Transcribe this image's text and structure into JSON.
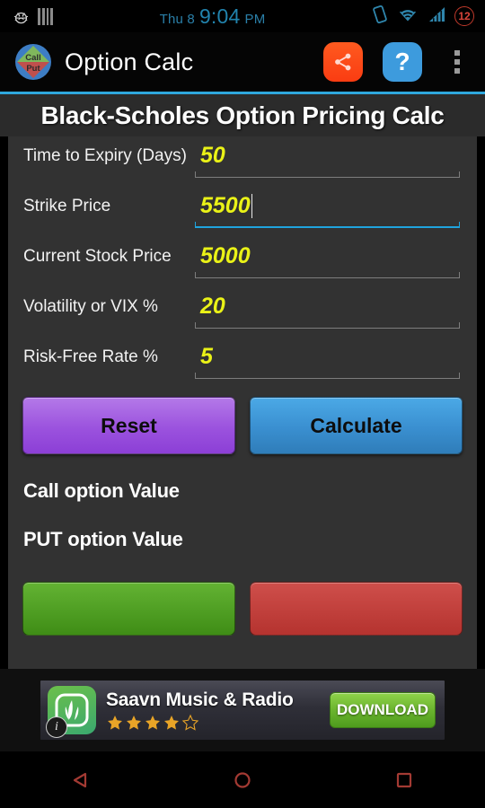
{
  "status_bar": {
    "icons_left": [
      "bug-icon",
      "barcode-icon"
    ],
    "day": "Thu 8",
    "time": "9:04",
    "meridiem": "PM",
    "icons_right": [
      "vibrate-icon",
      "wifi-icon",
      "signal-icon"
    ],
    "battery_level": "12",
    "battery_color": "#d8453a",
    "time_color": "#2183ad"
  },
  "action_bar": {
    "app_icon_call": "Call",
    "app_icon_put": "Put",
    "title": "Option Calc",
    "share_label": "share-icon",
    "help_label": "?",
    "overflow_label": "overflow-menu",
    "share_color": "#fa3c12",
    "help_color": "#3d9bdd",
    "divider_color": "#2fa8dd"
  },
  "page": {
    "title": "Black-Scholes Option Pricing Calc"
  },
  "form": {
    "fields": [
      {
        "label": "Time to Expiry (Days)",
        "value": "50",
        "focused": false
      },
      {
        "label": "Strike Price",
        "value": "5500",
        "focused": true
      },
      {
        "label": "Current Stock Price",
        "value": "5000",
        "focused": false
      },
      {
        "label": "Volatility or VIX  %",
        "value": "20",
        "focused": false
      },
      {
        "label": "Risk-Free Rate  %",
        "value": "5",
        "focused": false
      }
    ],
    "value_color": "#eaf217",
    "focus_color": "#1fa3dd"
  },
  "buttons": {
    "reset": "Reset",
    "calculate": "Calculate",
    "reset_color": "#9b52de",
    "calculate_color": "#3a8fd0"
  },
  "results": {
    "call_label": "Call option Value",
    "call_value": "",
    "put_label": "PUT option Value",
    "put_value": "",
    "green_button_color": "#3f8d16",
    "red_button_color": "#b5332f"
  },
  "ad": {
    "title": "Saavn Music & Radio",
    "rating": 4,
    "rating_max": 5,
    "cta": "DOWNLOAD",
    "info_badge": "i",
    "cta_color": "#6cb52f",
    "star_color": "#e8a427"
  },
  "nav_bar": {
    "back": "back-icon",
    "home": "home-icon",
    "recents": "recents-icon",
    "color": "#a33a33"
  }
}
